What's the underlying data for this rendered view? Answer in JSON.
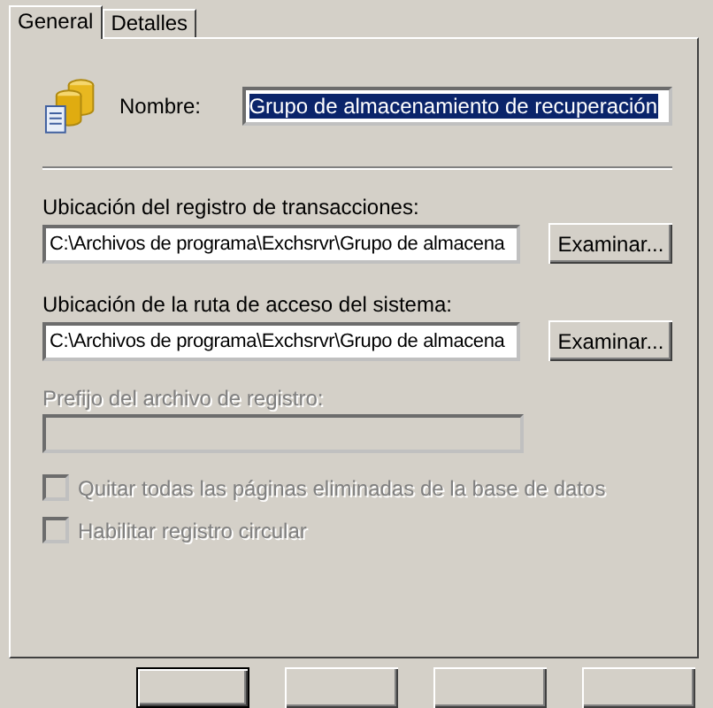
{
  "tabs": [
    {
      "label": "General",
      "selected": true
    },
    {
      "label": "Detalles",
      "selected": false
    }
  ],
  "name_field": {
    "label": "Nombre:",
    "value": "Grupo de almacenamiento de recuperación",
    "text_selected": true
  },
  "paths": [
    {
      "label": "Ubicación del registro de transacciones:",
      "value": "C:\\Archivos de programa\\Exchsrvr\\Grupo de almacena",
      "button": "Examinar..."
    },
    {
      "label": "Ubicación de la ruta de acceso del sistema:",
      "value": "C:\\Archivos de programa\\Exchsrvr\\Grupo de almacena",
      "button": "Examinar..."
    }
  ],
  "prefix_field": {
    "label": "Prefijo del archivo de registro:",
    "disabled": true
  },
  "checkboxes": [
    {
      "label": "Quitar todas las páginas eliminadas de la base de datos",
      "checked": false,
      "disabled": true
    },
    {
      "label": "Habilitar registro circular",
      "checked": false,
      "disabled": true
    }
  ],
  "buttons": [
    {
      "default": true
    },
    {
      "default": false
    },
    {
      "default": false
    },
    {
      "default": false
    }
  ]
}
